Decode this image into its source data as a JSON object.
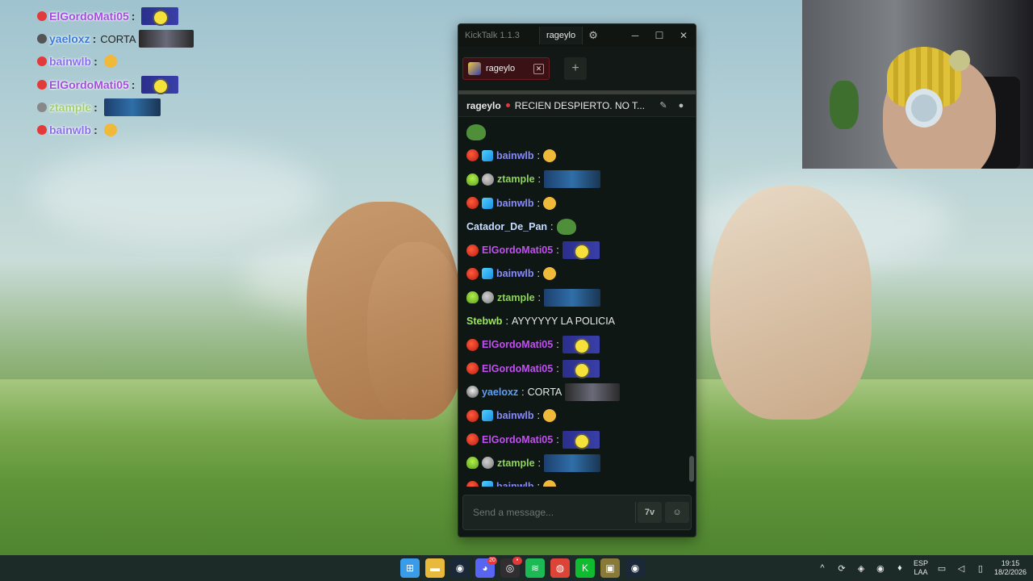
{
  "overlay": {
    "rows": [
      {
        "name": "ElGordoMati05",
        "sep": ":",
        "msg": "",
        "name_color": "#a24de0",
        "badge_color": "#e23a3a",
        "emote": "minion"
      },
      {
        "name": "yaeloxz",
        "sep": ":",
        "msg": "CORTA",
        "name_color": "#3a7bd5",
        "badge_color": "#555555",
        "emote": "corta"
      },
      {
        "name": "bainwlb",
        "sep": ":",
        "msg": "",
        "name_color": "#8a6ef0",
        "badge_color": "#e23a3a",
        "emote": "face"
      },
      {
        "name": "ElGordoMati05",
        "sep": ":",
        "msg": "",
        "name_color": "#a24de0",
        "badge_color": "#e23a3a",
        "emote": "minion"
      },
      {
        "name": "ztample",
        "sep": ":",
        "msg": "",
        "name_color": "#9fd06a",
        "badge_color": "#888888",
        "emote": "car"
      },
      {
        "name": "bainwlb",
        "sep": ":",
        "msg": "",
        "name_color": "#8a6ef0",
        "badge_color": "#e23a3a",
        "emote": "face"
      }
    ]
  },
  "window": {
    "app_title": "KickTalk 1.1.3",
    "user": "rageylo",
    "settings_icon": "gear-icon",
    "controls": {
      "minimize": "─",
      "maximize": "☐",
      "close": "✕"
    }
  },
  "tabs": {
    "items": [
      {
        "label": "rageylo",
        "close": "✕"
      }
    ],
    "add_label": "+"
  },
  "chat_header": {
    "channel": "rageylo",
    "title": "RECIEN DESPIERTO. NO T...",
    "live_color": "#e23a3a",
    "icons": [
      "pin-icon",
      "user-icon"
    ]
  },
  "messages": [
    {
      "name": "",
      "name_color": "",
      "text": "",
      "badges": [],
      "emote": "pepe"
    },
    {
      "name": "bainwlb",
      "name_color": "#8a8cf8",
      "text": "",
      "badges": [
        "red",
        "blue"
      ],
      "emote": "face"
    },
    {
      "name": "ztample",
      "name_color": "#8fd45a",
      "text": "",
      "badges": [
        "alien",
        "grey"
      ],
      "emote": "car"
    },
    {
      "name": "bainwlb",
      "name_color": "#8a8cf8",
      "text": "",
      "badges": [
        "red",
        "blue"
      ],
      "emote": "face"
    },
    {
      "name": "Catador_De_Pan",
      "name_color": "#c8ddff",
      "text": "",
      "badges": [],
      "emote": "pepe"
    },
    {
      "name": "ElGordoMati05",
      "name_color": "#c050f0",
      "text": "",
      "badges": [
        "red"
      ],
      "emote": "minion"
    },
    {
      "name": "bainwlb",
      "name_color": "#8a8cf8",
      "text": "",
      "badges": [
        "red",
        "blue"
      ],
      "emote": "face"
    },
    {
      "name": "ztample",
      "name_color": "#8fd45a",
      "text": "",
      "badges": [
        "alien",
        "grey"
      ],
      "emote": "car"
    },
    {
      "name": "Stebwb",
      "name_color": "#9ae85a",
      "text": "AYYYYYY LA POLICIA",
      "badges": [],
      "emote": ""
    },
    {
      "name": "ElGordoMati05",
      "name_color": "#c050f0",
      "text": "",
      "badges": [
        "red"
      ],
      "emote": "minion"
    },
    {
      "name": "ElGordoMati05",
      "name_color": "#c050f0",
      "text": "",
      "badges": [
        "red"
      ],
      "emote": "minion"
    },
    {
      "name": "yaeloxz",
      "name_color": "#5aa0ff",
      "text": "CORTA",
      "badges": [
        "skull"
      ],
      "emote": "corta"
    },
    {
      "name": "bainwlb",
      "name_color": "#8a8cf8",
      "text": "",
      "badges": [
        "red",
        "blue"
      ],
      "emote": "face"
    },
    {
      "name": "ElGordoMati05",
      "name_color": "#c050f0",
      "text": "",
      "badges": [
        "red"
      ],
      "emote": "minion"
    },
    {
      "name": "ztample",
      "name_color": "#8fd45a",
      "text": "",
      "badges": [
        "alien",
        "grey"
      ],
      "emote": "car"
    },
    {
      "name": "bainwlb",
      "name_color": "#8a8cf8",
      "text": "",
      "badges": [
        "red",
        "blue"
      ],
      "emote": "face"
    }
  ],
  "input": {
    "placeholder": "Send a message...",
    "value": "",
    "translate_label": "7v",
    "emote_icon": "emote-icon"
  },
  "taskbar": {
    "apps": [
      {
        "name": "windows-start-icon",
        "glyph": "⊞",
        "color": "#3a9be8",
        "badge": ""
      },
      {
        "name": "file-explorer-icon",
        "glyph": "▬",
        "color": "#e8b93a",
        "badge": ""
      },
      {
        "name": "steam-icon",
        "glyph": "◉",
        "color": "#1b2838",
        "badge": ""
      },
      {
        "name": "discord-icon",
        "glyph": "◕",
        "color": "#5865f2",
        "badge": "20"
      },
      {
        "name": "obs-icon",
        "glyph": "◎",
        "color": "#302e31",
        "badge": "•"
      },
      {
        "name": "spotify-icon",
        "glyph": "≋",
        "color": "#1db954",
        "badge": ""
      },
      {
        "name": "chrome-icon",
        "glyph": "◍",
        "color": "#db4437",
        "badge": ""
      },
      {
        "name": "kick-icon",
        "glyph": "K",
        "color": "#0fbb2f",
        "badge": ""
      },
      {
        "name": "app-icon",
        "glyph": "▣",
        "color": "#8a7a3a",
        "badge": ""
      },
      {
        "name": "steam-2-icon",
        "glyph": "◉",
        "color": "#1b2838",
        "badge": ""
      }
    ],
    "tray": {
      "chevron": "^",
      "lang_line1": "ESP",
      "lang_line2": "LAA",
      "time": "19:15",
      "date": "18/2/2026"
    }
  }
}
